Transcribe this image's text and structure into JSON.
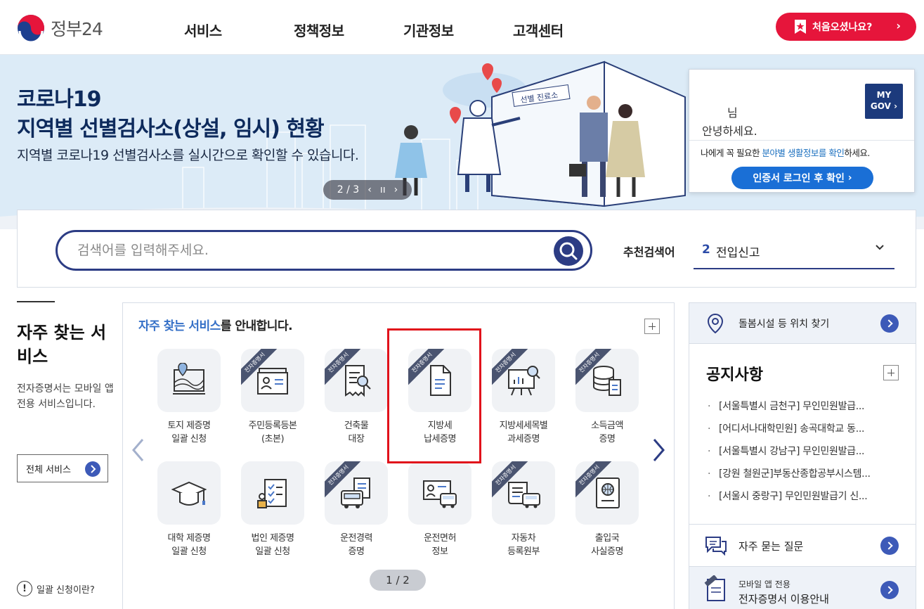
{
  "header": {
    "logo_text": "정부24",
    "nav": [
      "서비스",
      "정책정보",
      "기관정보",
      "고객센터"
    ],
    "first_visit_label": "처음오셨나요?"
  },
  "banner": {
    "title_line1": "코로나19",
    "title_line2": "지역별 선별검사소(상설, 임시) 현황",
    "subtitle": "지역별 코로나19 선별검사소를 실시간으로 확인할 수 있습니다.",
    "pager": "2 / 3",
    "tent_sign": "선별 진료소"
  },
  "mygov": {
    "name_suffix": "님",
    "greeting": "안녕하세요.",
    "badge_line1": "MY",
    "badge_line2": "GOV",
    "desc_prefix": "나에게 꼭 필요한 ",
    "desc_highlight": "분야별 생활정보를 확인",
    "desc_suffix": "하세요.",
    "login_button": "인증서 로그인 후 확인"
  },
  "search": {
    "placeholder": "검색어를 입력해주세요.",
    "recommend_label": "추천검색어",
    "recommend_num": "2",
    "recommend_text": "전입신고"
  },
  "left": {
    "title": "자주 찾는 서비스",
    "description": "전자증명서는 모바일 앱 전용 서비스입니다.",
    "all_services": "전체 서비스",
    "bulk_help": "일괄 신청이란?"
  },
  "services": {
    "heading_highlight": "자주 찾는 서비스",
    "heading_rest": "를 안내합니다.",
    "ribbon_text": "전자증명서",
    "pager": "1 / 2",
    "items": [
      {
        "line1": "토지 제증명",
        "line2": "일괄 신청",
        "icon": "land-map-icon",
        "ribbon": false
      },
      {
        "line1": "주민등록등본",
        "line2": "(초본)",
        "icon": "id-card-icon",
        "ribbon": true
      },
      {
        "line1": "건축물",
        "line2": "대장",
        "icon": "building-register-icon",
        "ribbon": true
      },
      {
        "line1": "지방세",
        "line2": "납세증명",
        "icon": "document-icon",
        "ribbon": true
      },
      {
        "line1": "지방세세목별",
        "line2": "과세증명",
        "icon": "presentation-chart-icon",
        "ribbon": true
      },
      {
        "line1": "소득금액",
        "line2": "증명",
        "icon": "database-doc-icon",
        "ribbon": true
      },
      {
        "line1": "대학 제증명",
        "line2": "일괄 신청",
        "icon": "graduation-cap-icon",
        "ribbon": false
      },
      {
        "line1": "법인 제증명",
        "line2": "일괄 신청",
        "icon": "corporate-checklist-icon",
        "ribbon": false
      },
      {
        "line1": "운전경력",
        "line2": "증명",
        "icon": "driving-record-icon",
        "ribbon": true
      },
      {
        "line1": "운전면허",
        "line2": "정보",
        "icon": "driver-license-icon",
        "ribbon": false
      },
      {
        "line1": "자동차",
        "line2": "등록원부",
        "icon": "car-registration-icon",
        "ribbon": true
      },
      {
        "line1": "출입국",
        "line2": "사실증명",
        "icon": "passport-icon",
        "ribbon": true
      }
    ]
  },
  "right": {
    "care_label": "돌봄시설 등 위치 찾기",
    "notice_title": "공지사항",
    "notices": [
      "[서울특별시 금천구] 무인민원발급...",
      "[어디서나대학민원] 송곡대학교 동...",
      "[서울특별시 강남구] 무인민원발급...",
      "[강원 철원군]부동산종합공부시스템...",
      "[서울시 중랑구] 무인민원발급기 신..."
    ],
    "faq_label": "자주 묻는 질문",
    "mobile_sub": "모바일 앱 전용",
    "mobile_label": "전자증명서 이용안내"
  },
  "colors": {
    "brand_navy": "#2c3c84",
    "accent_red": "#e6153b",
    "link_blue": "#3570c7",
    "highlight_box": "#e1121b"
  }
}
